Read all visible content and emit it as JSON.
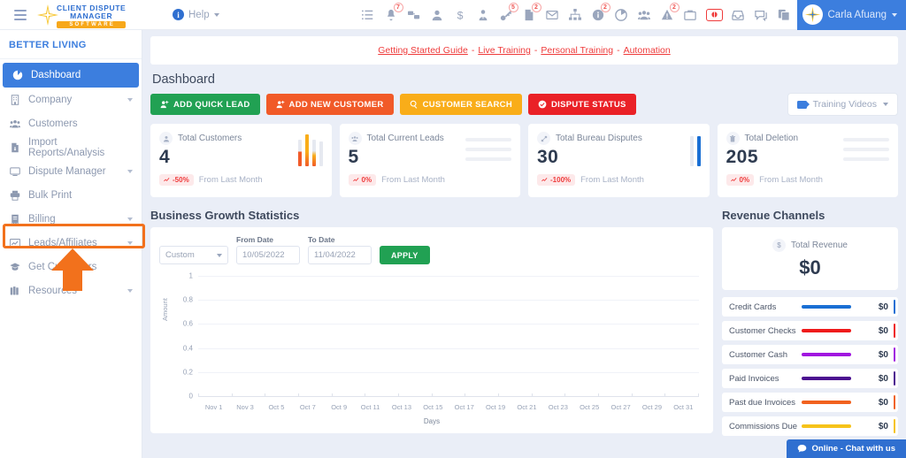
{
  "header": {
    "logo": {
      "line1": "CLIENT DISPUTE",
      "line2": "MANAGER",
      "line3": "SOFTWARE"
    },
    "help_label": "Help",
    "icons": [
      {
        "name": "list-icon",
        "badge": ""
      },
      {
        "name": "bell-icon",
        "badge": "7"
      },
      {
        "name": "network-share-icon",
        "badge": ""
      },
      {
        "name": "user-icon",
        "badge": ""
      },
      {
        "name": "dollar-icon",
        "badge": ""
      },
      {
        "name": "user-tie-icon",
        "badge": ""
      },
      {
        "name": "key-icon",
        "badge": "5"
      },
      {
        "name": "document-icon",
        "badge": "2"
      },
      {
        "name": "envelope-icon",
        "badge": ""
      },
      {
        "name": "sitemap-icon",
        "badge": ""
      },
      {
        "name": "info-icon",
        "badge": "2"
      },
      {
        "name": "pie-chart-icon",
        "badge": ""
      },
      {
        "name": "users-icon",
        "badge": ""
      },
      {
        "name": "warning-icon",
        "badge": "2"
      },
      {
        "name": "briefcase-icon",
        "badge": ""
      },
      {
        "name": "money-icon",
        "badge": ""
      },
      {
        "name": "inbox-icon",
        "badge": ""
      },
      {
        "name": "chat-icon",
        "badge": ""
      },
      {
        "name": "copy-icon",
        "badge": ""
      }
    ],
    "profile_name": "Carla Afuang"
  },
  "sidebar": {
    "org_name": "BETTER LIVING",
    "items": [
      {
        "label": "Dashboard",
        "icon": "dashboard-icon",
        "active": true,
        "caret": false
      },
      {
        "label": "Company",
        "icon": "building-icon",
        "active": false,
        "caret": true
      },
      {
        "label": "Customers",
        "icon": "users-icon",
        "active": false,
        "caret": false
      },
      {
        "label": "Import Reports/Analysis",
        "icon": "file-import-icon",
        "active": false,
        "caret": false
      },
      {
        "label": "Dispute Manager",
        "icon": "monitor-icon",
        "active": false,
        "caret": true
      },
      {
        "label": "Bulk Print",
        "icon": "printer-icon",
        "active": false,
        "caret": false
      },
      {
        "label": "Billing",
        "icon": "invoice-icon",
        "active": false,
        "caret": true
      },
      {
        "label": "Leads/Affiliates",
        "icon": "chart-line-icon",
        "active": false,
        "caret": true
      },
      {
        "label": "Get Customers",
        "icon": "graduation-cap-icon",
        "active": false,
        "caret": false
      },
      {
        "label": "Resources",
        "icon": "books-icon",
        "active": false,
        "caret": true
      }
    ],
    "highlight": "Leads/Affiliates"
  },
  "topLinks": {
    "items": [
      "Getting Started Guide",
      "Live Training",
      "Personal Training",
      "Automation"
    ],
    "separator": "-"
  },
  "main": {
    "page_title": "Dashboard",
    "buttons": [
      {
        "label": "ADD QUICK LEAD",
        "color": "green",
        "icon": "user-plus-icon"
      },
      {
        "label": "ADD NEW CUSTOMER",
        "color": "orange",
        "icon": "user-plus-icon"
      },
      {
        "label": "CUSTOMER SEARCH",
        "color": "yellow",
        "icon": "search-icon"
      },
      {
        "label": "DISPUTE STATUS",
        "color": "red",
        "icon": "check-circle-icon"
      }
    ],
    "training_videos_label": "Training Videos"
  },
  "stats": [
    {
      "title": "Total Customers",
      "value": "4",
      "change": "-50%",
      "note": "From Last Month",
      "icon": "user-icon",
      "viz": "bars"
    },
    {
      "title": "Total Current Leads",
      "value": "5",
      "change": "0%",
      "note": "From Last Month",
      "icon": "users-icon",
      "viz": "lines"
    },
    {
      "title": "Total Bureau Disputes",
      "value": "30",
      "change": "-100%",
      "note": "From Last Month",
      "icon": "link-icon",
      "viz": "bars2"
    },
    {
      "title": "Total Deletion",
      "value": "205",
      "change": "0%",
      "note": "From Last Month",
      "icon": "trash-icon",
      "viz": "lines"
    }
  ],
  "growth": {
    "title": "Business Growth Statistics",
    "range_label": "Custom",
    "from_label": "From Date",
    "from_value": "10/05/2022",
    "to_label": "To Date",
    "to_value": "11/04/2022",
    "apply_label": "APPLY"
  },
  "chart_data": {
    "type": "line",
    "title": "Business Growth Statistics",
    "xlabel": "Days",
    "ylabel": "Amount",
    "x": [
      "Nov 1",
      "Nov 3",
      "Oct 5",
      "Oct 7",
      "Oct 9",
      "Oct 11",
      "Oct 13",
      "Oct 15",
      "Oct 17",
      "Oct 19",
      "Oct 21",
      "Oct 23",
      "Oct 25",
      "Oct 27",
      "Oct 29",
      "Oct 31"
    ],
    "yticks": [
      "0",
      "0.2",
      "0.4",
      "0.6",
      "0.8",
      "1"
    ],
    "ylim": [
      0,
      1
    ],
    "grid": true,
    "legend": "none",
    "series": [
      {
        "name": "Amount",
        "values": [
          0,
          0,
          0,
          0,
          0,
          0,
          0,
          0,
          0,
          0,
          0,
          0,
          0,
          0,
          0,
          0
        ]
      }
    ]
  },
  "revenue": {
    "title": "Revenue Channels",
    "total_label": "Total Revenue",
    "total_value": "$0",
    "currency_icon": "$",
    "channels": [
      {
        "name": "Credit Cards",
        "value": "$0",
        "color": "#1a6fd4"
      },
      {
        "name": "Customer Checks",
        "value": "$0",
        "color": "#ef1b1b"
      },
      {
        "name": "Customer Cash",
        "value": "$0",
        "color": "#a016e0"
      },
      {
        "name": "Paid Invoices",
        "value": "$0",
        "color": "#4b1090"
      },
      {
        "name": "Past due Invoices",
        "value": "$0",
        "color": "#f1621f"
      },
      {
        "name": "Commissions Due",
        "value": "$0",
        "color": "#f6c31a"
      }
    ]
  },
  "chat": {
    "label": "Online - Chat with us"
  }
}
